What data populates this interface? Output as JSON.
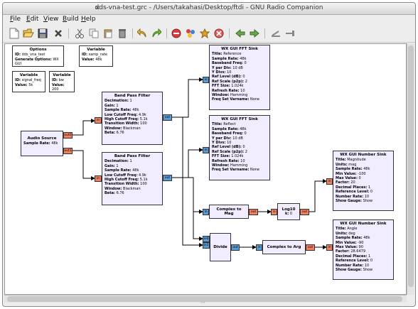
{
  "window": {
    "title": "dds-vna-test.grc - /Users/takahasi/Desktop/ftdi - GNU Radio Companion"
  },
  "menu": {
    "items": [
      {
        "key": "F",
        "rest": "ile"
      },
      {
        "key": "E",
        "rest": "dit"
      },
      {
        "key": "V",
        "rest": "iew"
      },
      {
        "key": "B",
        "rest": "uild"
      },
      {
        "key": "H",
        "rest": "elp"
      }
    ]
  },
  "toolbar": {
    "icons": [
      "new-icon",
      "open-icon",
      "save-icon",
      "close-icon",
      "cut-icon",
      "copy-icon",
      "paste-icon",
      "delete-icon",
      "undo-icon",
      "redo-icon",
      "disable-icon",
      "generate-icon",
      "execute-icon",
      "stop-icon",
      "back-icon",
      "forward-icon",
      "rotate-ccw-icon",
      "rotate-cw-icon"
    ]
  },
  "colors": {
    "block_bg": "#f1ecff",
    "port_complex": "#5b9bd5",
    "port_float": "#f08060"
  },
  "blocks": {
    "options": {
      "title": "Options",
      "rows": [
        [
          "ID:",
          "dds_vna_test"
        ],
        [
          "Generate Options:",
          "WX GUI"
        ]
      ]
    },
    "var_samp_rate": {
      "title": "Variable",
      "rows": [
        [
          "ID:",
          "samp_rate"
        ],
        [
          "Value:",
          "48k"
        ]
      ]
    },
    "var_signal_freq": {
      "title": "Variable",
      "rows": [
        [
          "ID:",
          "signal_freq"
        ],
        [
          "Value:",
          "5k"
        ]
      ]
    },
    "var_bw": {
      "title": "Variable",
      "rows": [
        [
          "ID:",
          "bw"
        ],
        [
          "Value:",
          "200"
        ]
      ]
    },
    "audio_source": {
      "title": "Audio Source",
      "rows": [
        [
          "Sample Rate:",
          "48k"
        ]
      ],
      "ports": [
        "out0",
        "out1"
      ]
    },
    "bpf1": {
      "title": "Band Pass Filter",
      "rows": [
        [
          "Decimation:",
          "1"
        ],
        [
          "Gain:",
          "1"
        ],
        [
          "Sample Rate:",
          "48k"
        ],
        [
          "Low Cutoff Freq:",
          "4.9k"
        ],
        [
          "High Cutoff Freq:",
          "5.1k"
        ],
        [
          "Transition Width:",
          "100"
        ],
        [
          "Window:",
          "Blackman"
        ],
        [
          "Beta:",
          "6.76"
        ]
      ]
    },
    "bpf2": {
      "title": "Band Pass Filter",
      "rows": [
        [
          "Decimation:",
          "1"
        ],
        [
          "Gain:",
          "1"
        ],
        [
          "Sample Rate:",
          "48k"
        ],
        [
          "Low Cutoff Freq:",
          "4.9k"
        ],
        [
          "High Cutoff Freq:",
          "5.1k"
        ],
        [
          "Transition Width:",
          "100"
        ],
        [
          "Window:",
          "Blackman"
        ],
        [
          "Beta:",
          "6.76"
        ]
      ]
    },
    "fft1": {
      "title": "WX GUI FFT Sink",
      "rows": [
        [
          "Title:",
          "Reference"
        ],
        [
          "Sample Rate:",
          "48k"
        ],
        [
          "Baseband Freq:",
          "0"
        ],
        [
          "Y per Div:",
          "10 dB"
        ],
        [
          "Y Divs:",
          "10"
        ],
        [
          "Ref Level (dB):",
          "0"
        ],
        [
          "Ref Scale (p2p):",
          "2"
        ],
        [
          "FFT Size:",
          "1.024k"
        ],
        [
          "Refresh Rate:",
          "10"
        ],
        [
          "Window:",
          "Hamming"
        ],
        [
          "Freq Set Varname:",
          "None"
        ]
      ]
    },
    "fft2": {
      "title": "WX GUI FFT Sink",
      "rows": [
        [
          "Title:",
          "Reflect"
        ],
        [
          "Sample Rate:",
          "48k"
        ],
        [
          "Baseband Freq:",
          "0"
        ],
        [
          "Y per Div:",
          "10 dB"
        ],
        [
          "Y Divs:",
          "10"
        ],
        [
          "Ref Level (dB):",
          "0"
        ],
        [
          "Ref Scale (p2p):",
          "2"
        ],
        [
          "FFT Size:",
          "1.024k"
        ],
        [
          "Refresh Rate:",
          "10"
        ],
        [
          "Window:",
          "Hamming"
        ],
        [
          "Freq Set Varname:",
          "None"
        ]
      ]
    },
    "num1": {
      "title": "WX GUI Number Sink",
      "rows": [
        [
          "Title:",
          "Magnitude"
        ],
        [
          "Units:",
          "mag"
        ],
        [
          "Sample Rate:",
          "48k"
        ],
        [
          "Min Value:",
          "-100"
        ],
        [
          "Max Value:",
          "0"
        ],
        [
          "Factor:",
          "20"
        ],
        [
          "Decimal Places:",
          "1"
        ],
        [
          "Reference Level:",
          "0"
        ],
        [
          "Number Rate:",
          "10"
        ],
        [
          "Show Gauge:",
          "Show"
        ]
      ]
    },
    "num2": {
      "title": "WX GUI Number Sink",
      "rows": [
        [
          "Title:",
          "Angle"
        ],
        [
          "Units:",
          "deg"
        ],
        [
          "Sample Rate:",
          "48k"
        ],
        [
          "Min Value:",
          "-90"
        ],
        [
          "Max Value:",
          "90"
        ],
        [
          "Factor:",
          "28.6479"
        ],
        [
          "Decimal Places:",
          "1"
        ],
        [
          "Reference Level:",
          "0"
        ],
        [
          "Number Rate:",
          "10"
        ],
        [
          "Show Gauge:",
          "Show"
        ]
      ]
    },
    "complex_to_mag": {
      "title": "Complex to Mag"
    },
    "log10": {
      "title": "Log10",
      "rows": [
        [
          "k:",
          "0"
        ]
      ]
    },
    "divide": {
      "title": "Divide"
    },
    "complex_to_arg": {
      "title": "Complex to Arg"
    }
  },
  "ports": {
    "out0": "out0",
    "out1": "out1",
    "in": "in",
    "out": "out",
    "in0": "in0",
    "in1": "in1"
  }
}
